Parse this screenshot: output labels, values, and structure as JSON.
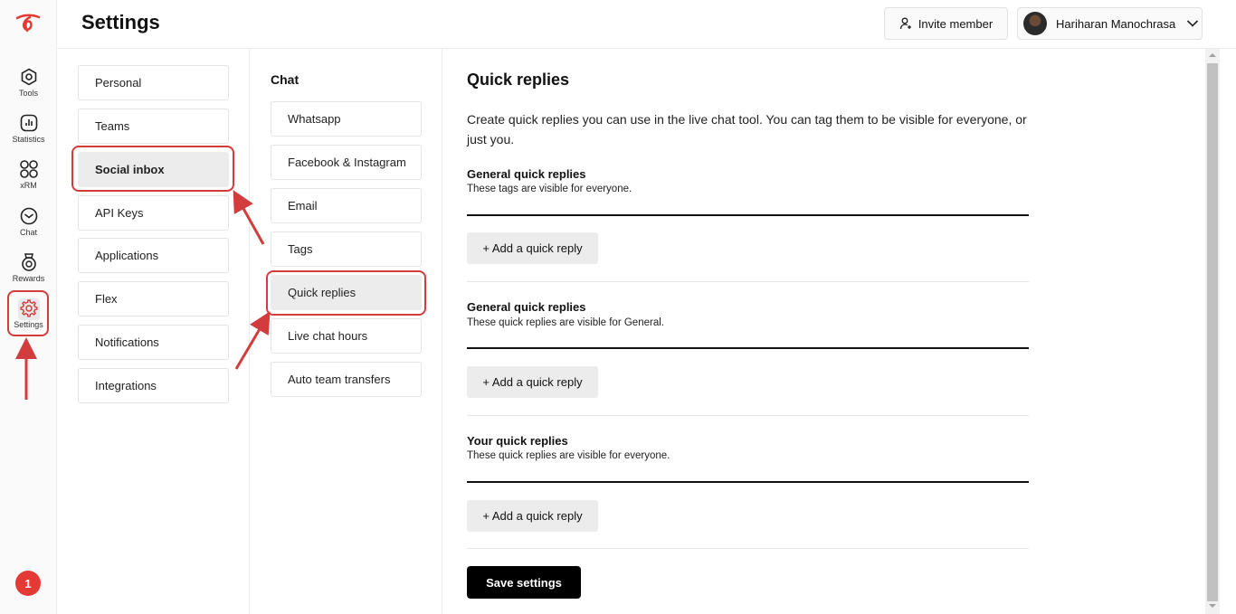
{
  "rail": {
    "items": [
      {
        "label": "Tools",
        "icon": "hexagon-icon"
      },
      {
        "label": "Statistics",
        "icon": "bar-chart-icon"
      },
      {
        "label": "xRM",
        "icon": "grid-icon"
      },
      {
        "label": "Chat",
        "icon": "chat-icon"
      },
      {
        "label": "Rewards",
        "icon": "medal-icon"
      },
      {
        "label": "Settings",
        "icon": "gear-icon"
      }
    ],
    "notification_count": "1"
  },
  "header": {
    "title": "Settings",
    "invite_label": "Invite member",
    "user_name": "Hariharan Manochrasa"
  },
  "settings_menu": {
    "items": [
      "Personal",
      "Teams",
      "Social inbox",
      "API Keys",
      "Applications",
      "Flex",
      "Notifications",
      "Integrations"
    ],
    "active": "Social inbox"
  },
  "chat_menu": {
    "title": "Chat",
    "items": [
      "Whatsapp",
      "Facebook & Instagram",
      "Email",
      "Tags",
      "Quick replies",
      "Live chat hours",
      "Auto team transfers"
    ],
    "active": "Quick replies"
  },
  "main": {
    "title": "Quick replies",
    "intro": "Create quick replies you can use in the live chat tool. You can tag them to be visible for everyone, or just you.",
    "sections": [
      {
        "title": "General quick replies",
        "description": "These tags are visible for everyone.",
        "add_label": "+ Add a quick reply"
      },
      {
        "title": "General quick replies",
        "description": "These quick replies are visible for General.",
        "add_label": "+ Add a quick reply"
      },
      {
        "title": "Your quick replies",
        "description": "These quick replies are visible for everyone.",
        "add_label": "+ Add a quick reply"
      }
    ],
    "save_label": "Save settings"
  },
  "colors": {
    "annotation": "#d23c3c",
    "badge": "#e53935",
    "primary_button": "#000000",
    "active_item": "#ececec"
  }
}
